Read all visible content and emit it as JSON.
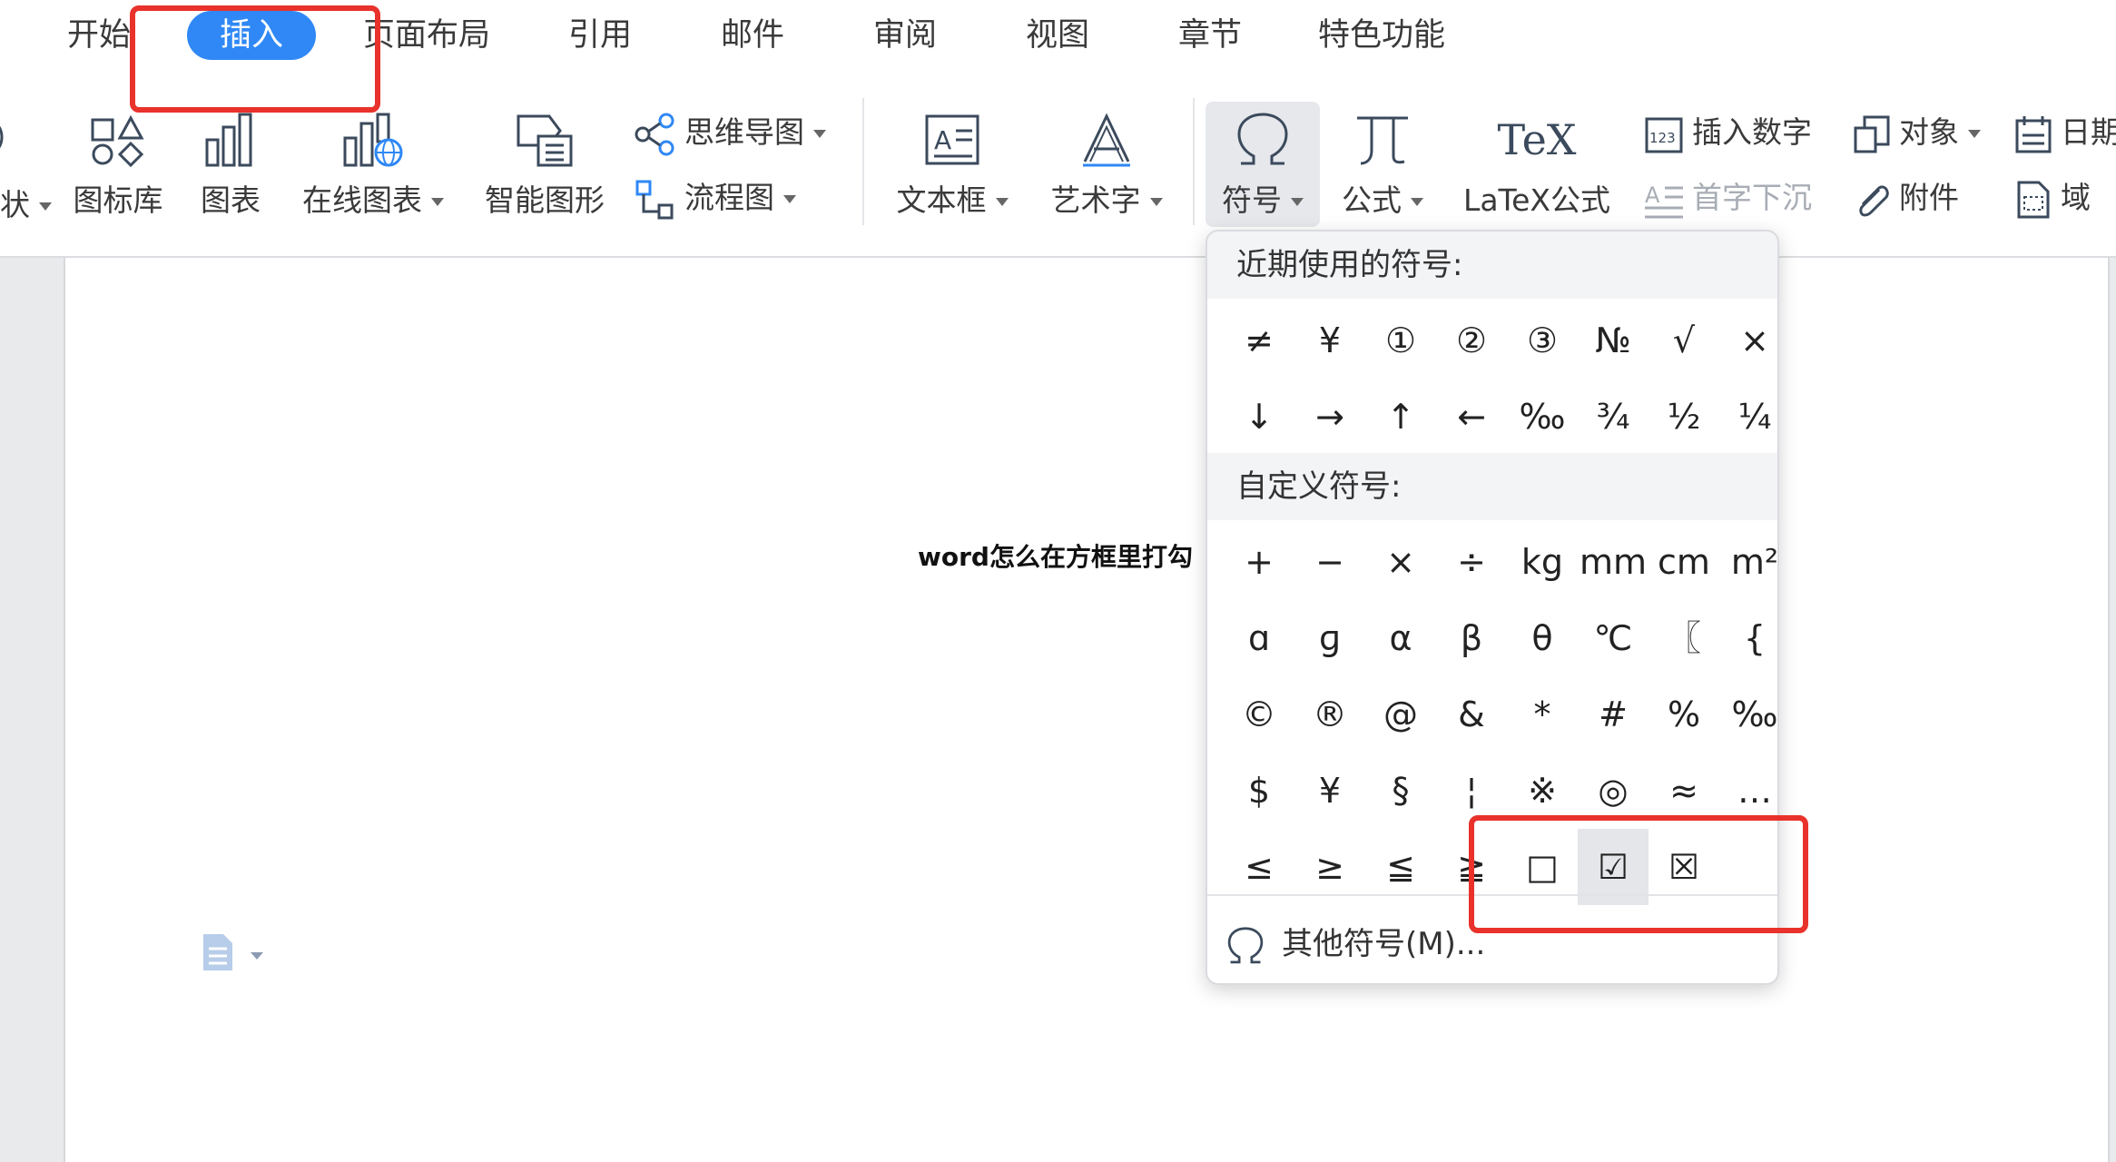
{
  "menu": {
    "items": [
      "开始",
      "插入",
      "页面布局",
      "引用",
      "邮件",
      "审阅",
      "视图",
      "章节",
      "特色功能"
    ],
    "active": "插入"
  },
  "ribbon": {
    "partial_left": "状",
    "icon_library": "图标库",
    "chart": "图表",
    "online_chart": "在线图表",
    "smart_shape": "智能图形",
    "mind_map": "思维导图",
    "flowchart": "流程图",
    "text_box": "文本框",
    "word_art": "艺术字",
    "symbol": "符号",
    "formula": "公式",
    "latex_icon": "TeX",
    "latex": "LaTeX公式",
    "insert_number": "插入数字",
    "drop_cap": "首字下沉",
    "object": "对象",
    "attachment": "附件",
    "date": "日期",
    "field": "域"
  },
  "document": {
    "title": "word怎么在方框里打勾"
  },
  "symbol_popup": {
    "recent_header": "近期使用的符号:",
    "recent_row1": [
      "≠",
      "¥",
      "①",
      "②",
      "③",
      "№",
      "√",
      "×"
    ],
    "recent_row2": [
      "↓",
      "→",
      "↑",
      "←",
      "‰",
      "¾",
      "½",
      "¼"
    ],
    "custom_header": "自定义符号:",
    "custom_rows": [
      [
        "+",
        "−",
        "×",
        "÷",
        "kg",
        "mm",
        "cm",
        "m²"
      ],
      [
        "ɑ",
        "ɡ",
        "α",
        "β",
        "θ",
        "℃",
        "〖",
        "{"
      ],
      [
        "©",
        "®",
        "@",
        "&",
        "*",
        "#",
        "%",
        "‰"
      ],
      [
        "$",
        "¥",
        "§",
        "¦",
        "※",
        "◎",
        "≈",
        "…"
      ],
      [
        "≤",
        "≥",
        "≦",
        "≧",
        "□",
        "☑",
        "☒",
        ""
      ]
    ],
    "selected_symbol": "☑",
    "more_symbols": "其他符号(M)..."
  },
  "colors": {
    "accent": "#2f88f5",
    "annotation": "#e8322b",
    "icon": "#3b4a5c"
  }
}
